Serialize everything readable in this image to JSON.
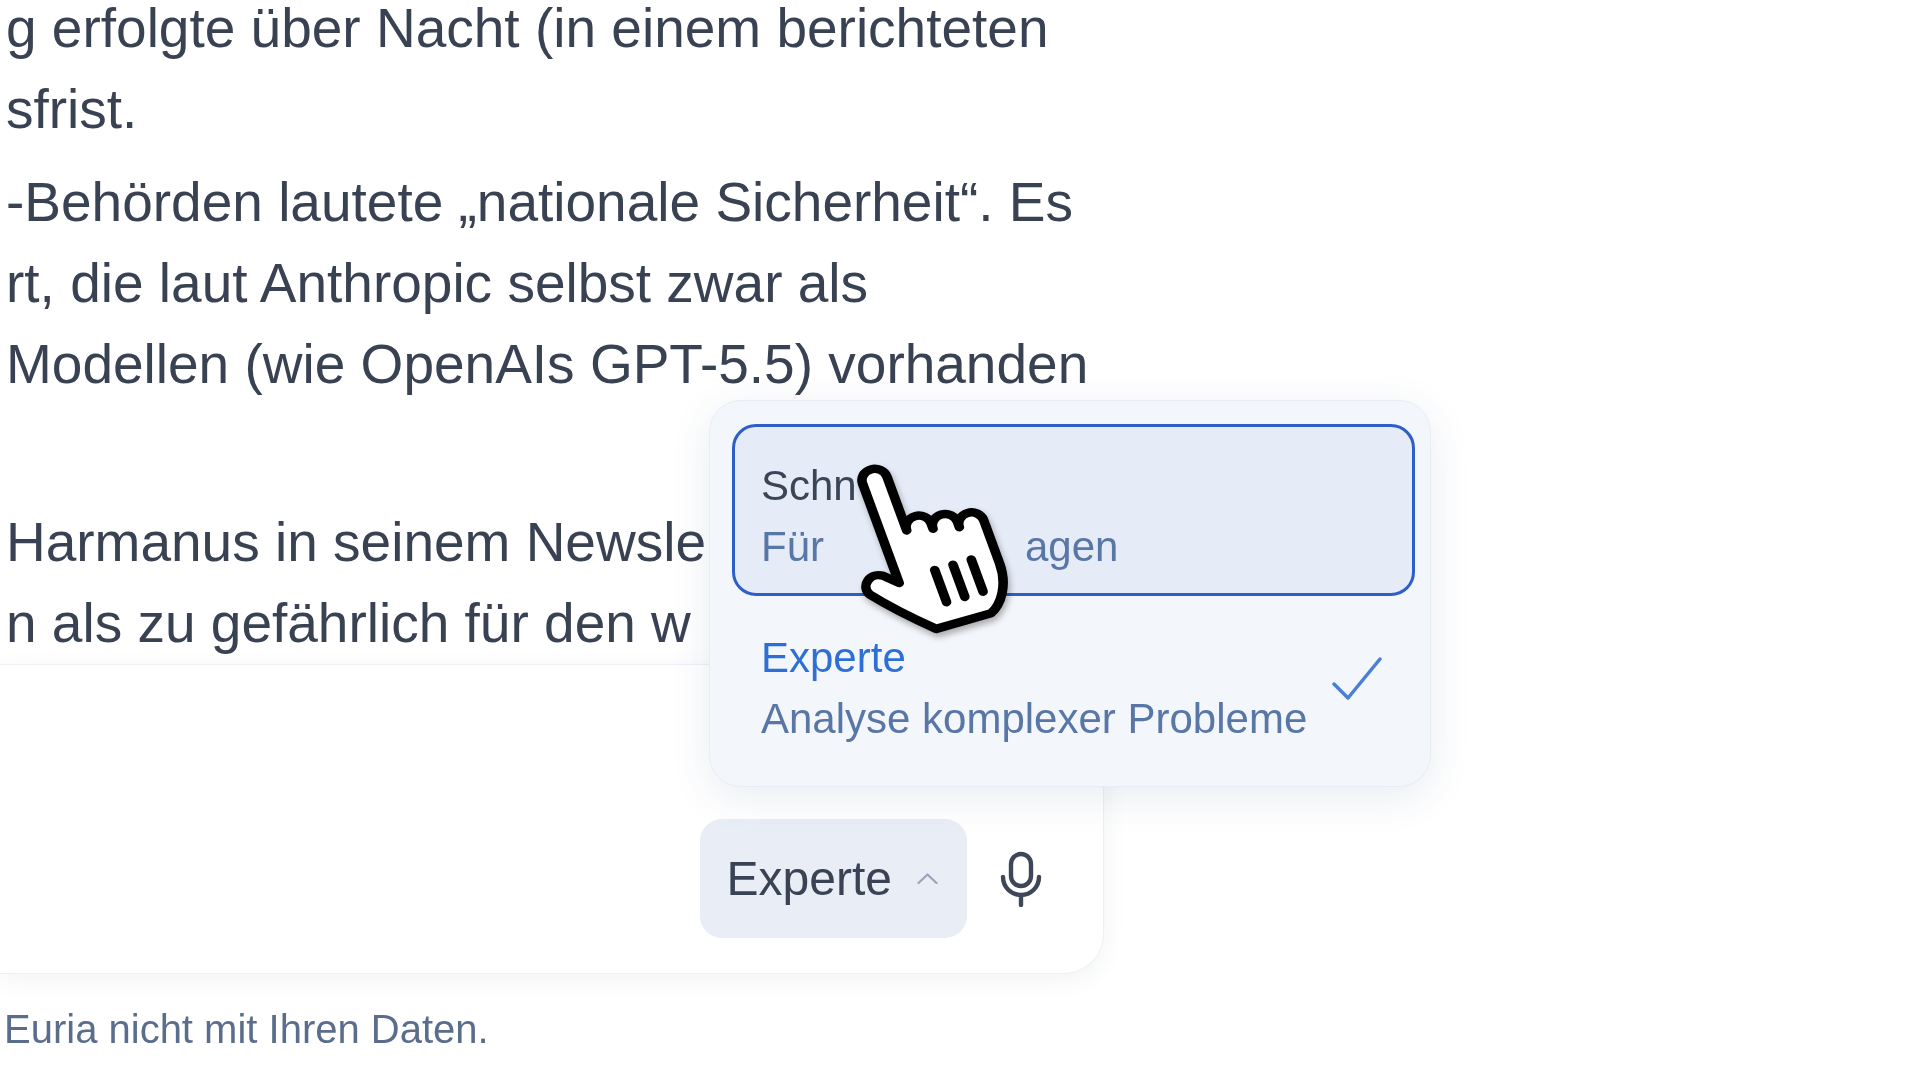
{
  "message": {
    "paragraphs": [
      {
        "lines": [
          "g erfolgte über Nacht (in einem berichteten",
          "sfrist."
        ]
      },
      {
        "lines": [
          "-Behörden lautete „nationale Sicherheit“. Es",
          "rt, die laut Anthropic selbst zwar als",
          "Modellen (wie OpenAIs GPT-5.5) vorhanden"
        ]
      },
      {
        "lines": [
          "Harmanus in seinem Newsle",
          "n als zu gefährlich für den w"
        ]
      }
    ]
  },
  "composer": {
    "mode_button": {
      "label": "Experte",
      "expanded": true
    }
  },
  "mode_menu": {
    "options": [
      {
        "title": "Schn",
        "description": [
          "Für",
          "agen"
        ],
        "highlighted": true,
        "selected": false
      },
      {
        "title": "Experte",
        "description": [
          "Analyse komplexer Probleme"
        ],
        "highlighted": false,
        "selected": true
      }
    ]
  },
  "footer_note": "Euria nicht mit Ihren Daten."
}
